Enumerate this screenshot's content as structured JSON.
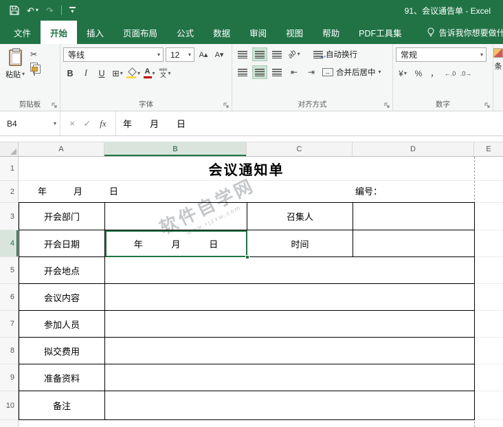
{
  "titlebar": {
    "title": "91、会议通告单 - Excel"
  },
  "tabs": {
    "items": [
      "文件",
      "开始",
      "插入",
      "页面布局",
      "公式",
      "数据",
      "审阅",
      "视图",
      "帮助",
      "PDF工具集"
    ],
    "active": "开始",
    "tell_me": "告诉我你想要做什么"
  },
  "ribbon": {
    "clipboard": {
      "label": "剪贴板",
      "paste": "粘贴"
    },
    "font": {
      "label": "字体",
      "font_name": "等线",
      "font_size": "12",
      "bold": "B",
      "italic": "I",
      "underline": "U",
      "pinyin_top": "wén",
      "pinyin_bottom": "文"
    },
    "alignment": {
      "label": "对齐方式",
      "wrap_text": "自动换行",
      "merge_center": "合并后居中",
      "orientation": "ab"
    },
    "number": {
      "label": "数字",
      "format": "常规"
    },
    "partial": {
      "label": "条"
    }
  },
  "formula_bar": {
    "name_box": "B4",
    "cancel": "×",
    "enter": "✓",
    "fx": "fx",
    "content": "年　　月　　日"
  },
  "grid": {
    "col_headers": [
      "A",
      "B",
      "C",
      "D",
      "E"
    ],
    "row_headers": [
      "1",
      "2",
      "3",
      "4",
      "5",
      "6",
      "7",
      "8",
      "9",
      "10"
    ],
    "selected_cell": "B4",
    "selected_column": "B",
    "selected_row": "4"
  },
  "sheet": {
    "title": "会议通知单",
    "date_line": "年　　　月　　　日",
    "number_label": "编号：",
    "row3": {
      "a": "开会部门",
      "c": "召集人"
    },
    "row4": {
      "a": "开会日期",
      "b1": "年",
      "b2": "月",
      "b3": "日",
      "c": "时间"
    },
    "row5": {
      "a": "开会地点"
    },
    "row6": {
      "a": "会议内容"
    },
    "row7": {
      "a": "参加人员"
    },
    "row8": {
      "a": "拟交费用"
    },
    "row9": {
      "a": "准备资料"
    },
    "row10": {
      "a": "备注"
    }
  },
  "watermark": {
    "line1": "软件自学网",
    "line2": "www.rjzxw.com"
  },
  "icons": {
    "undo": "↶",
    "redo": "↷",
    "scissors": "✂",
    "borders": "⊞",
    "grow_font": "A▴",
    "shrink_font": "A▾",
    "indent_left": "⇤",
    "indent_right": "⇥",
    "currency": "¥",
    "percent": "%",
    "comma": "，",
    "inc_decimal": "←.0",
    "dec_decimal": ".0→"
  },
  "colors": {
    "accent": "#217346",
    "selection_border": "#217346",
    "font_color_bar": "#c00000",
    "fill_color_bar": "#ffd646"
  }
}
